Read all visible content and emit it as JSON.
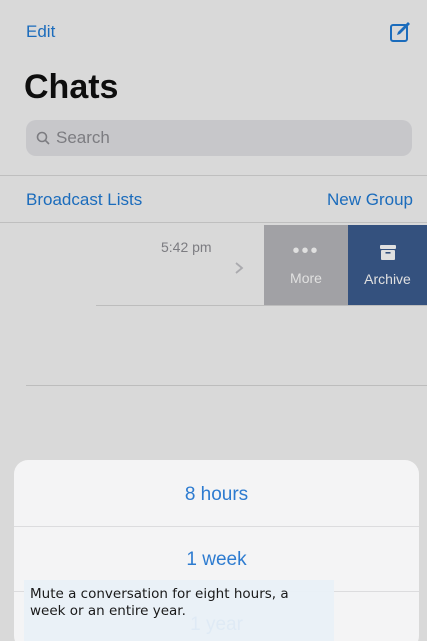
{
  "header": {
    "edit_label": "Edit",
    "compose_icon": "compose-icon",
    "title": "Chats"
  },
  "search": {
    "placeholder": "Search",
    "icon": "search-icon"
  },
  "links": {
    "broadcast_lists": "Broadcast Lists",
    "new_group": "New Group"
  },
  "chat_row": {
    "time": "5:42 pm",
    "chevron_icon": "chevron-right-icon",
    "swipe_actions": [
      {
        "label": "More",
        "icon": "ellipsis-icon",
        "color": "#b8b8bc"
      },
      {
        "label": "Archive",
        "icon": "archive-icon",
        "color": "#3c5d90"
      }
    ]
  },
  "mute_sheet": {
    "options": [
      {
        "label": "8 hours"
      },
      {
        "label": "1 week"
      },
      {
        "label": "1 year"
      }
    ],
    "accent": "#2d7bd0"
  },
  "caption": {
    "text": "Mute a conversation for eight hours, a week or an entire year."
  },
  "colors": {
    "link": "#1f7bd6",
    "background": "#f7f7f8"
  }
}
